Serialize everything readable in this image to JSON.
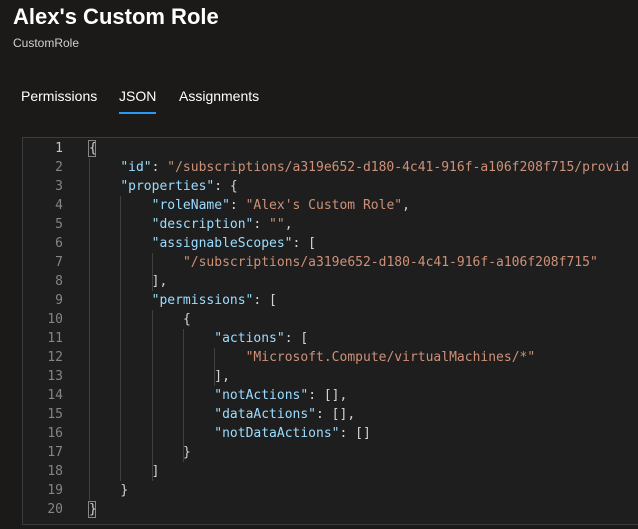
{
  "header": {
    "title": "Alex's Custom Role",
    "subtitle": "CustomRole"
  },
  "tabs": [
    {
      "label": "Permissions",
      "active": false
    },
    {
      "label": "JSON",
      "active": true
    },
    {
      "label": "Assignments",
      "active": false
    }
  ],
  "editor": {
    "current_line": 1,
    "lines": [
      {
        "n": "1",
        "indent": 0,
        "tokens": [
          {
            "t": "p",
            "v": "{"
          }
        ]
      },
      {
        "n": "2",
        "indent": 1,
        "tokens": [
          {
            "t": "k",
            "v": "\"id\""
          },
          {
            "t": "p",
            "v": ": "
          },
          {
            "t": "s",
            "v": "\"/subscriptions/a319e652-d180-4c41-916f-a106f208f715/provid"
          }
        ]
      },
      {
        "n": "3",
        "indent": 1,
        "tokens": [
          {
            "t": "k",
            "v": "\"properties\""
          },
          {
            "t": "p",
            "v": ": {"
          }
        ]
      },
      {
        "n": "4",
        "indent": 2,
        "tokens": [
          {
            "t": "k",
            "v": "\"roleName\""
          },
          {
            "t": "p",
            "v": ": "
          },
          {
            "t": "s",
            "v": "\"Alex's Custom Role\""
          },
          {
            "t": "p",
            "v": ","
          }
        ]
      },
      {
        "n": "5",
        "indent": 2,
        "tokens": [
          {
            "t": "k",
            "v": "\"description\""
          },
          {
            "t": "p",
            "v": ": "
          },
          {
            "t": "s",
            "v": "\"\""
          },
          {
            "t": "p",
            "v": ","
          }
        ]
      },
      {
        "n": "6",
        "indent": 2,
        "tokens": [
          {
            "t": "k",
            "v": "\"assignableScopes\""
          },
          {
            "t": "p",
            "v": ": ["
          }
        ]
      },
      {
        "n": "7",
        "indent": 3,
        "tokens": [
          {
            "t": "s",
            "v": "\"/subscriptions/a319e652-d180-4c41-916f-a106f208f715\""
          }
        ]
      },
      {
        "n": "8",
        "indent": 2,
        "tokens": [
          {
            "t": "p",
            "v": "],"
          }
        ]
      },
      {
        "n": "9",
        "indent": 2,
        "tokens": [
          {
            "t": "k",
            "v": "\"permissions\""
          },
          {
            "t": "p",
            "v": ": ["
          }
        ]
      },
      {
        "n": "10",
        "indent": 3,
        "tokens": [
          {
            "t": "p",
            "v": "{"
          }
        ]
      },
      {
        "n": "11",
        "indent": 4,
        "tokens": [
          {
            "t": "k",
            "v": "\"actions\""
          },
          {
            "t": "p",
            "v": ": ["
          }
        ]
      },
      {
        "n": "12",
        "indent": 5,
        "tokens": [
          {
            "t": "s",
            "v": "\"Microsoft.Compute/virtualMachines/*\""
          }
        ]
      },
      {
        "n": "13",
        "indent": 4,
        "tokens": [
          {
            "t": "p",
            "v": "],"
          }
        ]
      },
      {
        "n": "14",
        "indent": 4,
        "tokens": [
          {
            "t": "k",
            "v": "\"notActions\""
          },
          {
            "t": "p",
            "v": ": [],"
          }
        ]
      },
      {
        "n": "15",
        "indent": 4,
        "tokens": [
          {
            "t": "k",
            "v": "\"dataActions\""
          },
          {
            "t": "p",
            "v": ": [],"
          }
        ]
      },
      {
        "n": "16",
        "indent": 4,
        "tokens": [
          {
            "t": "k",
            "v": "\"notDataActions\""
          },
          {
            "t": "p",
            "v": ": []"
          }
        ]
      },
      {
        "n": "17",
        "indent": 3,
        "tokens": [
          {
            "t": "p",
            "v": "}"
          }
        ]
      },
      {
        "n": "18",
        "indent": 2,
        "tokens": [
          {
            "t": "p",
            "v": "]"
          }
        ]
      },
      {
        "n": "19",
        "indent": 1,
        "tokens": [
          {
            "t": "p",
            "v": "}"
          }
        ]
      },
      {
        "n": "20",
        "indent": 0,
        "tokens": [
          {
            "t": "p",
            "v": "}"
          }
        ]
      }
    ]
  },
  "colors": {
    "background": "#1b1a19",
    "editor_background": "#1e1e1e",
    "accent": "#2899f5",
    "json_key": "#9cdcfe",
    "json_string": "#ce9178",
    "punctuation": "#d4d4d4",
    "line_number": "#858585"
  }
}
